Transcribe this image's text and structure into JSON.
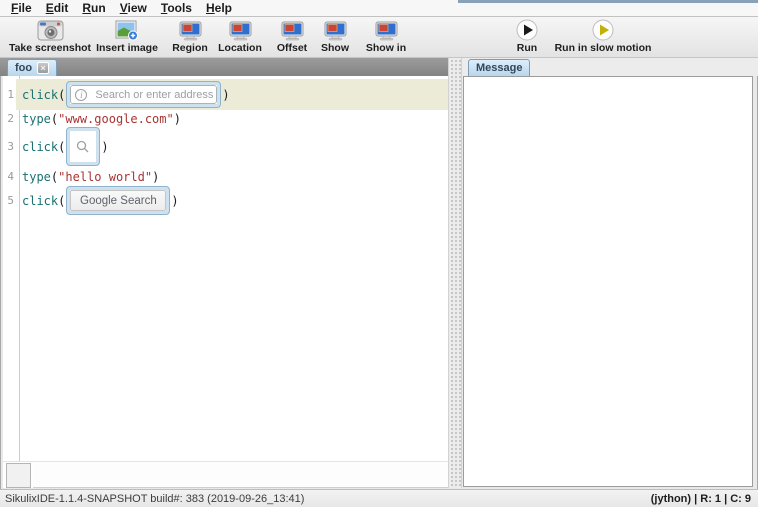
{
  "menu": {
    "items": [
      {
        "first": "F",
        "rest": "ile"
      },
      {
        "first": "E",
        "rest": "dit"
      },
      {
        "first": "R",
        "rest": "un"
      },
      {
        "first": "V",
        "rest": "iew"
      },
      {
        "first": "T",
        "rest": "ools"
      },
      {
        "first": "H",
        "rest": "elp"
      }
    ]
  },
  "toolbar": {
    "items": [
      {
        "label": "Take screenshot",
        "icon": "camera-icon"
      },
      {
        "label": "Insert image",
        "icon": "image-plus-icon"
      },
      {
        "label": "Region",
        "icon": "monitor-icon"
      },
      {
        "label": "Location",
        "icon": "monitor-icon"
      },
      {
        "label": "Offset",
        "icon": "monitor-icon"
      },
      {
        "label": "Show",
        "icon": "monitor-icon"
      },
      {
        "label": "Show in",
        "icon": "monitor-icon"
      },
      {
        "label": "Run",
        "icon": "run-icon"
      },
      {
        "label": "Run in slow motion",
        "icon": "run-slow-icon"
      }
    ]
  },
  "editor": {
    "tab": {
      "label": "foo",
      "close": "×"
    },
    "lines": [
      {
        "num": "1",
        "fn": "click",
        "open": "(",
        "close": ")",
        "image": {
          "kind": "address-bar",
          "icon": "info-icon",
          "placeholder": "Search or enter address"
        }
      },
      {
        "num": "2",
        "fn": "type",
        "open": "(",
        "str": "\"www.google.com\"",
        "close": ")"
      },
      {
        "num": "3",
        "fn": "click",
        "open": "(",
        "close": ")",
        "image": {
          "kind": "search-button",
          "icon": "magnifier-icon"
        }
      },
      {
        "num": "4",
        "fn": "type",
        "open": "(",
        "str": "\"hello world\"",
        "close": ")"
      },
      {
        "num": "5",
        "fn": "click",
        "open": "(",
        "close": ")",
        "image": {
          "kind": "google-search-button",
          "label": "Google Search"
        }
      }
    ]
  },
  "message_panel": {
    "tab": "Message"
  },
  "status": {
    "left": "SikulixIDE-1.1.4-SNAPSHOT build#: 383 (2019-09-26_13:41)",
    "right": "(jython) | R: 1 | C: 9"
  },
  "colors": {
    "keyword": "#1a7272",
    "string": "#aa3333",
    "current_line_highlight": "#ebebd8",
    "selected_tab": "#cfe4f5",
    "thumbnail_border": "#8fb3cc",
    "tab_strip": "#8e8e8e",
    "run_triangle": "#1a1a1a",
    "run_slow_triangle": "#c2b007",
    "monitor_screen_blue": "#3a7fd5",
    "monitor_screen_red": "#cc4433"
  }
}
